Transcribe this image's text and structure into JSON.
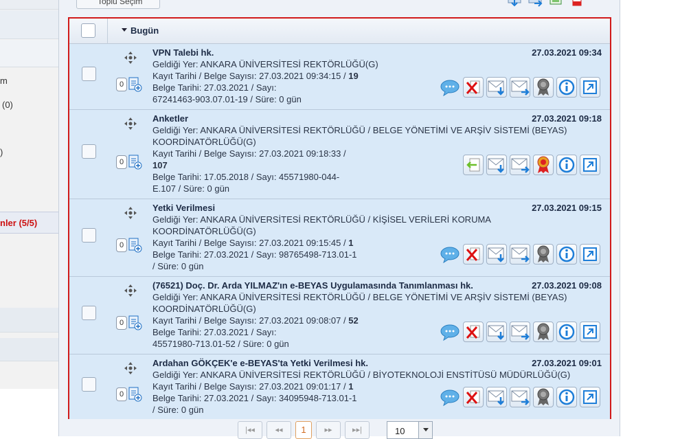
{
  "sidebar": {
    "item_m": "m",
    "item_count0": "(0)",
    "item_paren": ")",
    "active_label": "nler (5/5)"
  },
  "toolbar": {
    "bulk_select_label": "Toplu Seçim"
  },
  "group": {
    "label": "Bugün"
  },
  "rows": [
    {
      "title": "VPN Talebi hk.",
      "date": "27.03.2021 09:34",
      "lines": [
        "Geldiği Yer: ANKARA ÜNİVERSİTESİ REKTÖRLÜĞÜ(G)",
        "Kayıt Tarihi / Belge Sayısı: 27.03.2021 09:34:15 / ",
        "Belge Tarihi: 27.03.2021 / Sayı:",
        "67241463-903.07.01-19 / Süre: 0 gün"
      ],
      "doc_no": "19",
      "attachments": "0"
    },
    {
      "title": "Anketler",
      "date": "27.03.2021 09:18",
      "lines": [
        "Geldiği Yer: ANKARA ÜNİVERSİTESİ REKTÖRLÜĞÜ / BELGE YÖNETİMİ VE ARŞİV SİSTEMİ (BEYAS)",
        "KOORDİNATÖRLÜĞÜ(G)",
        "Kayıt Tarihi / Belge Sayısı: 27.03.2021 09:18:33 /",
        "Belge Tarihi: 17.05.2018 / Sayı: 45571980-044-",
        "E.107 / Süre: 0 gün"
      ],
      "doc_no": "107",
      "attachments": "0"
    },
    {
      "title": "Yetki Verilmesi",
      "date": "27.03.2021 09:15",
      "lines": [
        "Geldiği Yer: ANKARA ÜNİVERSİTESİ REKTÖRLÜĞÜ / KİŞİSEL VERİLERİ KORUMA",
        "KOORDİNATÖRLÜĞÜ(G)",
        "Kayıt Tarihi / Belge Sayısı: 27.03.2021 09:15:45 / ",
        "Belge Tarihi: 27.03.2021 / Sayı: 98765498-713.01-1",
        "/ Süre: 0 gün"
      ],
      "doc_no": "1",
      "attachments": "0"
    },
    {
      "title": "(76521) Doç. Dr. Arda YILMAZ'ın e-BEYAS Uygulamasında Tanımlanması hk.",
      "date": "27.03.2021 09:08",
      "lines": [
        "Geldiği Yer: ANKARA ÜNİVERSİTESİ REKTÖRLÜĞÜ / BELGE YÖNETİMİ VE ARŞİV SİSTEMİ (BEYAS)",
        "KOORDİNATÖRLÜĞÜ(G)",
        "Kayıt Tarihi / Belge Sayısı: 27.03.2021 09:08:07 / ",
        "Belge Tarihi: 27.03.2021 / Sayı:",
        "45571980-713.01-52 / Süre: 0 gün"
      ],
      "doc_no": "52",
      "attachments": "0"
    },
    {
      "title": "Ardahan GÖKÇEK'e e-BEYAS'ta Yetki Verilmesi hk.",
      "date": "27.03.2021 09:01",
      "lines": [
        "Geldiği Yer: ANKARA ÜNİVERSİTESİ REKTÖRLÜĞÜ / BİYOTEKNOLOJİ ENSTİTÜSÜ MÜDÜRLÜĞÜ(G)",
        "Kayıt Tarihi / Belge Sayısı: 27.03.2021 09:01:17 / ",
        "Belge Tarihi: 27.03.2021 / Sayı: 34095948-713.01-1",
        "/ Süre: 0 gün"
      ],
      "doc_no": "1",
      "attachments": "0"
    }
  ],
  "pager": {
    "current_page": "1",
    "page_size": "10"
  },
  "colors": {
    "highlight_border": "#d11a1a",
    "row_bg": "#d9e9f8",
    "title_text": "#1d2b45",
    "active_sidebar_text": "#cc1111",
    "current_page": "#d2691e"
  }
}
